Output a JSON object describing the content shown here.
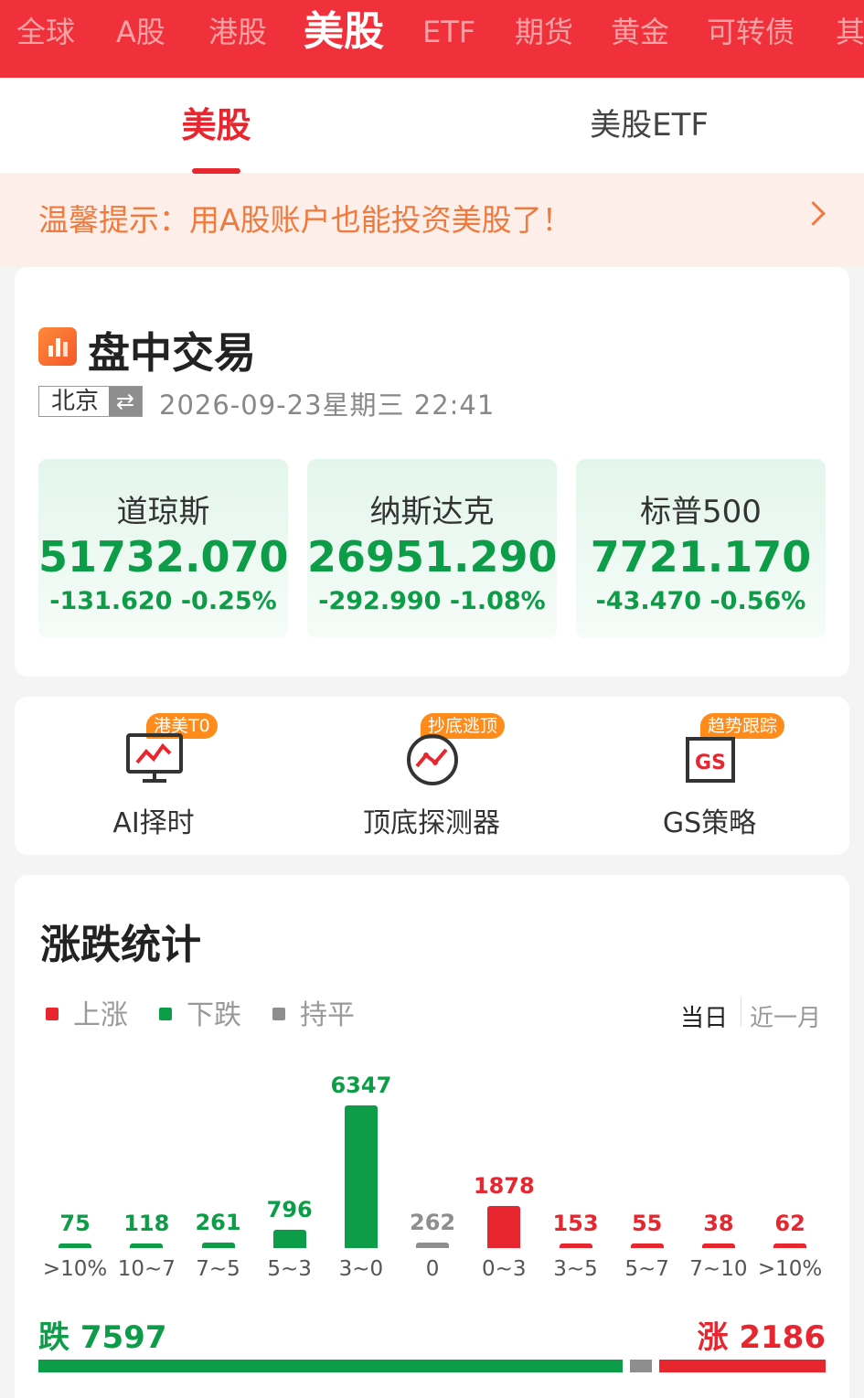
{
  "top_nav": {
    "tabs": [
      "全球",
      "A股",
      "港股",
      "美股",
      "ETF",
      "期货",
      "黄金",
      "可转债",
      "其"
    ],
    "active": "美股"
  },
  "sub_tabs": {
    "tabs": [
      "美股",
      "美股ETF"
    ],
    "active": "美股"
  },
  "notice": {
    "text": "温馨提示：用A股账户也能投资美股了！"
  },
  "trading": {
    "title": "盘中交易",
    "city": "北京",
    "swap_icon": "⇄",
    "datetime": "2026-09-23星期三   22:41",
    "indices": [
      {
        "name": "道琼斯",
        "value": "51732.070",
        "change": "-131.620  -0.25%"
      },
      {
        "name": "纳斯达克",
        "value": "26951.290",
        "change": "-292.990  -1.08%"
      },
      {
        "name": "标普500",
        "value": "7721.170",
        "change": "-43.470  -0.56%"
      }
    ]
  },
  "tools": [
    {
      "label": "AI择时",
      "badge": "港美T0",
      "icon": "monitor-chart-icon"
    },
    {
      "label": "顶底探测器",
      "badge": "抄底逃顶",
      "icon": "detector-icon"
    },
    {
      "label": "GS策略",
      "badge": "趋势跟踪",
      "icon": "gs-strategy-icon",
      "icon_text": "GS"
    }
  ],
  "stats": {
    "title": "涨跌统计",
    "legend": [
      "上涨",
      "下跌",
      "持平"
    ],
    "period": {
      "today": "当日",
      "month": "近一月",
      "active": "当日"
    },
    "total_fall_label": "跌",
    "total_fall": "7597",
    "total_rise_label": "涨",
    "total_rise": "2186",
    "colors": {
      "rise": "#e8262f",
      "fall": "#0d9c47",
      "flat": "#8e8e8e"
    }
  },
  "chart_data": {
    "type": "bar",
    "categories": [
      ">10%",
      "10~7",
      "7~5",
      "5~3",
      "3~0",
      "0",
      "0~3",
      "3~5",
      "5~7",
      "7~10",
      ">10%"
    ],
    "values": [
      75,
      118,
      261,
      796,
      6347,
      262,
      1878,
      153,
      55,
      38,
      62
    ],
    "groups": [
      "fall",
      "fall",
      "fall",
      "fall",
      "fall",
      "flat",
      "rise",
      "rise",
      "rise",
      "rise",
      "rise"
    ],
    "title": "涨跌统计"
  }
}
